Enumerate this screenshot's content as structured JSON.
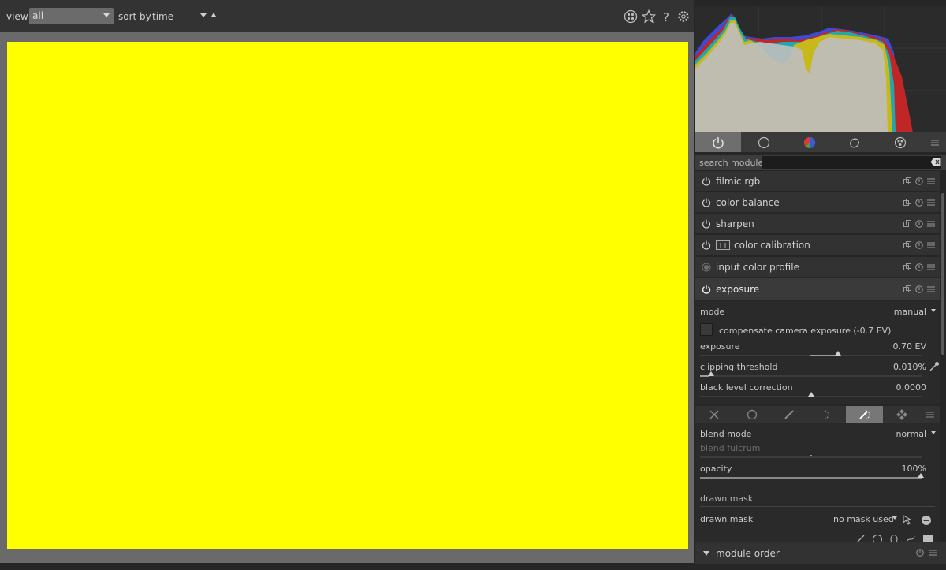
{
  "topbar": {
    "view_label": "view",
    "view_value": "all",
    "sort_label": "sort by",
    "sort_value": "time",
    "icons": [
      "grouping-icon",
      "star-icon",
      "help-icon",
      "gear-icon"
    ]
  },
  "center": {
    "image_color": "#ffff00",
    "background_color": "#6a6a6a"
  },
  "right_panel": {
    "group_tabs": [
      "power-icon",
      "circle-icon",
      "color-wheel-icon",
      "correct-icon",
      "effects-icon",
      "menu-icon"
    ],
    "search_label": "search module",
    "modules": [
      {
        "name": "filmic rgb"
      },
      {
        "name": "color balance"
      },
      {
        "name": "sharpen"
      },
      {
        "name": "color calibration"
      },
      {
        "name": "input color profile"
      },
      {
        "name": "exposure"
      }
    ],
    "exposure": {
      "mode_label": "mode",
      "mode_value": "manual",
      "compensate_label": "compensate camera exposure (-0.7 EV)",
      "exposure_label": "exposure",
      "exposure_value": "0.70 EV",
      "clipping_label": "clipping threshold",
      "clipping_value": "0.010%",
      "black_label": "black level correction",
      "black_value": "0.0000"
    },
    "blend": {
      "blend_mode_label": "blend mode",
      "blend_mode_value": "normal",
      "blend_fulcrum_label": "blend fulcrum",
      "opacity_label": "opacity",
      "opacity_value": "100%",
      "drawn_mask_header": "drawn mask",
      "drawn_mask_label": "drawn mask",
      "drawn_mask_value": "no mask used"
    },
    "module_order_label": "module order"
  }
}
